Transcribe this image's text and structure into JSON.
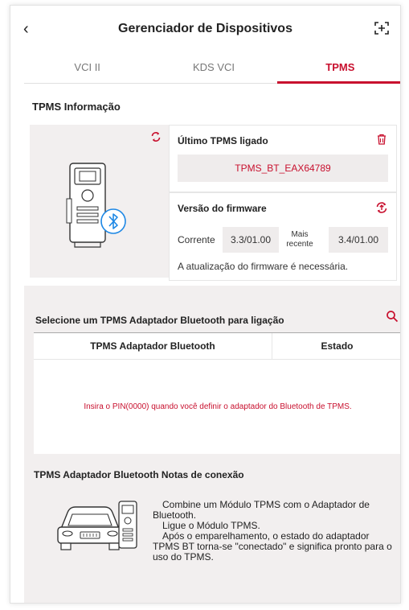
{
  "header": {
    "back_icon": "chevron-left-icon",
    "title": "Gerenciador de Dispositivos",
    "scan_icon": "scan-add-icon"
  },
  "tabs": [
    {
      "label": "VCI II",
      "active": false
    },
    {
      "label": "KDS VCI",
      "active": false
    },
    {
      "label": "TPMS",
      "active": true
    }
  ],
  "info": {
    "section_title": "TPMS Informação",
    "refresh_icon": "refresh-icon",
    "last_connected": {
      "title": "Último TPMS ligado",
      "value": "TPMS_BT_EAX64789",
      "delete_icon": "trash-icon"
    },
    "firmware": {
      "title": "Versão do firmware",
      "update_icon": "firmware-update-icon",
      "current_label": "Corrente",
      "current_value": "3.3/01.00",
      "latest_label_line1": "Mais",
      "latest_label_line2": "recente",
      "latest_value": "3.4/01.00",
      "note": "A atualização do firmware é necessária."
    }
  },
  "bluetooth": {
    "select_title": "Selecione um TPMS Adaptador Bluetooth para ligação",
    "search_icon": "search-icon",
    "columns": [
      "TPMS Adaptador Bluetooth",
      "Estado"
    ],
    "rows": [],
    "message": "Insira o PIN(0000) quando você definir o adaptador do Bluetooth de TPMS."
  },
  "notes": {
    "title": "TPMS Adaptador Bluetooth Notas de conexão",
    "lines": [
      "Combine um Módulo TPMS com o Adaptador de Bluetooth.",
      "Ligue o Módulo TPMS.",
      "Após o emparelhamento, o estado do adaptador TPMS BT torna-se \"conectado\" e significa pronto para o uso do TPMS."
    ]
  },
  "colors": {
    "accent": "#c8102e",
    "panel_bg": "#f2efef",
    "bluetooth": "#1e88e5"
  }
}
